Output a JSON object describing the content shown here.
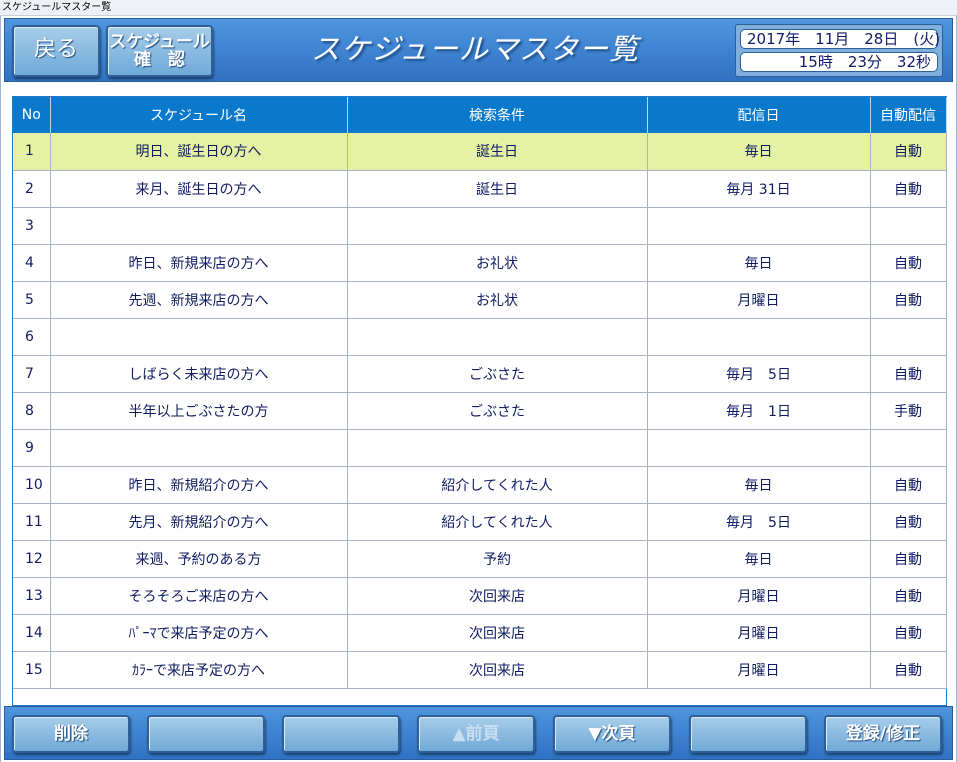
{
  "window": {
    "title": "スケジュールマスター覧"
  },
  "header": {
    "back_label": "戻る",
    "confirm_label_line1": "スケジュール",
    "confirm_label_line2": "確　認",
    "screen_title": "スケジュールマスター覧",
    "date": "2017年　11月　28日　(火)",
    "time": "15時　23分　32秒"
  },
  "table": {
    "columns": [
      "No",
      "スケジュール名",
      "検索条件",
      "配信日",
      "自動配信"
    ],
    "selected_row": 1,
    "rows": [
      {
        "no": "1",
        "name": "明日、誕生日の方へ",
        "condition": "誕生日",
        "date": "毎日",
        "auto": "自動"
      },
      {
        "no": "2",
        "name": "来月、誕生日の方へ",
        "condition": "誕生日",
        "date": "毎月 31日",
        "auto": "自動"
      },
      {
        "no": "3",
        "name": "",
        "condition": "",
        "date": "",
        "auto": ""
      },
      {
        "no": "4",
        "name": "昨日、新規来店の方へ",
        "condition": "お礼状",
        "date": "毎日",
        "auto": "自動"
      },
      {
        "no": "5",
        "name": "先週、新規来店の方へ",
        "condition": "お礼状",
        "date": "月曜日",
        "auto": "自動"
      },
      {
        "no": "6",
        "name": "",
        "condition": "",
        "date": "",
        "auto": ""
      },
      {
        "no": "7",
        "name": "しばらく未来店の方へ",
        "condition": "ごぶさた",
        "date": "毎月　5日",
        "auto": "自動"
      },
      {
        "no": "8",
        "name": "半年以上ごぶさたの方",
        "condition": "ごぶさた",
        "date": "毎月　1日",
        "auto": "手動"
      },
      {
        "no": "9",
        "name": "",
        "condition": "",
        "date": "",
        "auto": ""
      },
      {
        "no": "10",
        "name": "昨日、新規紹介の方へ",
        "condition": "紹介してくれた人",
        "date": "毎日",
        "auto": "自動"
      },
      {
        "no": "11",
        "name": "先月、新規紹介の方へ",
        "condition": "紹介してくれた人",
        "date": "毎月　5日",
        "auto": "自動"
      },
      {
        "no": "12",
        "name": "来週、予約のある方",
        "condition": "予約",
        "date": "毎日",
        "auto": "自動"
      },
      {
        "no": "13",
        "name": "そろそろご来店の方へ",
        "condition": "次回来店",
        "date": "月曜日",
        "auto": "自動"
      },
      {
        "no": "14",
        "name": "ﾊﾟｰﾏで来店予定の方へ",
        "condition": "次回来店",
        "date": "月曜日",
        "auto": "自動"
      },
      {
        "no": "15",
        "name": "ｶﾗｰで来店予定の方へ",
        "condition": "次回来店",
        "date": "月曜日",
        "auto": "自動"
      }
    ]
  },
  "footer": {
    "buttons": [
      {
        "label": "削除",
        "enabled": true
      },
      {
        "label": "",
        "enabled": true
      },
      {
        "label": "",
        "enabled": true
      },
      {
        "label": "▲前頁",
        "enabled": false
      },
      {
        "label": "▼次頁",
        "enabled": true
      },
      {
        "label": "",
        "enabled": true
      },
      {
        "label": "登録/修正",
        "enabled": true
      }
    ]
  },
  "colors": {
    "header_blue": "#2f72c3",
    "table_header": "#0a79cc",
    "selected_row": "#e5f2a3",
    "cell_text": "#0f1c63"
  }
}
